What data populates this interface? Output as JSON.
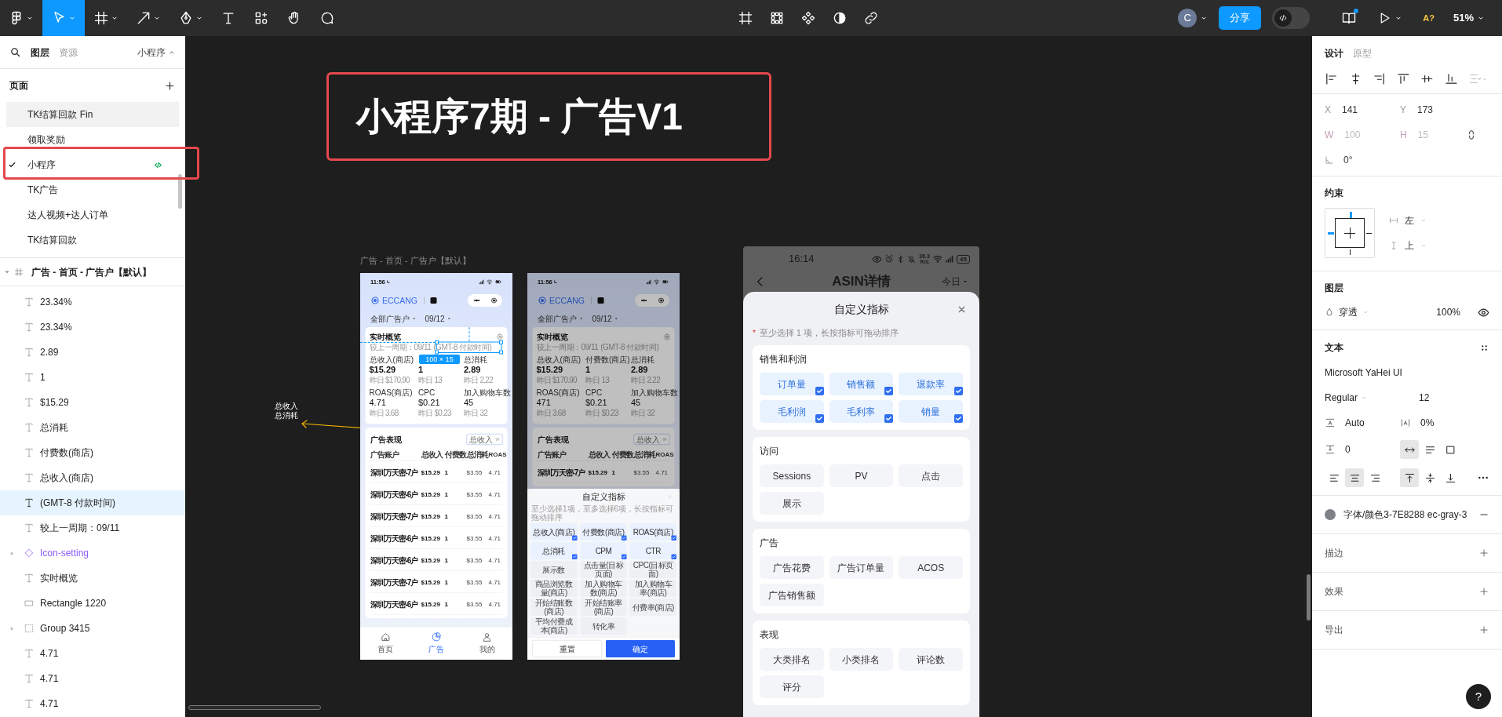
{
  "toolbar": {
    "tools": [
      {
        "kind": "main-menu",
        "selected": false
      },
      {
        "kind": "move",
        "selected": true
      },
      {
        "kind": "frame",
        "selected": false
      },
      {
        "kind": "shape",
        "selected": false
      },
      {
        "kind": "pen",
        "selected": false
      },
      {
        "kind": "text",
        "selected": false
      },
      {
        "kind": "actions",
        "selected": false
      },
      {
        "kind": "hand",
        "selected": false
      },
      {
        "kind": "comment",
        "selected": false
      }
    ],
    "avatar": "C",
    "share_button": "分享",
    "dev_mode": {
      "on": false
    },
    "notifications": true,
    "font_warning": "A?",
    "zoom": "51%"
  },
  "left_panel": {
    "tabs": [
      {
        "label": "图层",
        "selected": true
      },
      {
        "label": "资源",
        "selected": false
      }
    ],
    "page_switcher": "小程序",
    "pages_title": "页面",
    "pages": [
      {
        "label": "TK结算回款 Fin",
        "selected": false,
        "hovered": true,
        "dev_ready": false
      },
      {
        "label": "领取奖励",
        "selected": false,
        "hovered": false,
        "dev_ready": false
      },
      {
        "label": "小程序",
        "selected": true,
        "hovered": false,
        "dev_ready": true
      },
      {
        "label": "TK广告",
        "selected": false,
        "hovered": false,
        "dev_ready": false
      },
      {
        "label": "达人视频+达人订单",
        "selected": false,
        "hovered": false,
        "dev_ready": false
      },
      {
        "label": "TK结算回款",
        "selected": false,
        "hovered": false,
        "dev_ready": false
      }
    ],
    "frame": {
      "label": "广告 - 首页 - 广告户【默认】",
      "expanded": true
    },
    "layers": [
      {
        "kind": "text",
        "label": "23.34%",
        "selected": false
      },
      {
        "kind": "text",
        "label": "23.34%",
        "selected": false
      },
      {
        "kind": "text",
        "label": "2.89",
        "selected": false
      },
      {
        "kind": "text",
        "label": "1",
        "selected": false
      },
      {
        "kind": "text",
        "label": "$15.29",
        "selected": false
      },
      {
        "kind": "text",
        "label": "总消耗",
        "selected": false
      },
      {
        "kind": "text",
        "label": "付费数(商店)",
        "selected": false
      },
      {
        "kind": "text",
        "label": "总收入(商店)",
        "selected": false
      },
      {
        "kind": "text",
        "label": "(GMT-8 付款时间)",
        "selected": true
      },
      {
        "kind": "text",
        "label": "较上一周期：09/11",
        "selected": false
      },
      {
        "kind": "component",
        "label": "Icon-setting",
        "selected": false
      },
      {
        "kind": "text",
        "label": "实时概览",
        "selected": false
      },
      {
        "kind": "rectangle",
        "label": "Rectangle 1220",
        "selected": false
      },
      {
        "kind": "group",
        "label": "Group 3415",
        "selected": false
      },
      {
        "kind": "text",
        "label": "4.71",
        "selected": false
      },
      {
        "kind": "text",
        "label": "4.71",
        "selected": false
      },
      {
        "kind": "text",
        "label": "4.71",
        "selected": false
      }
    ]
  },
  "canvas": {
    "title": "小程序7期 - 广告V1",
    "frame_label": "广告 - 首页 - 广告户【默认】",
    "annotation": [
      "总收入",
      "总消耗"
    ],
    "phones": [
      {
        "kind": "ad-home",
        "time": "11:56",
        "brand": "ECCANG",
        "filters": [
          "全部广告户",
          "09/12"
        ],
        "overview": {
          "title": "实时概览",
          "compare": "较上一周期：09/11",
          "timezone": "(GMT-8 付款时间)",
          "metrics": [
            {
              "label": "总收入(商店)",
              "value": "$15.29",
              "prev": "昨日 $170.90"
            },
            {
              "value": "1",
              "prev": "昨日 13"
            },
            {
              "label": "总消耗",
              "value": "2.89",
              "prev": "昨日 2.22"
            },
            {
              "label": "ROAS(商店)",
              "value": "4.71",
              "prev": "昨日 3.68"
            },
            {
              "label": "CPC",
              "value": "$0.21",
              "prev": "昨日 $0.23"
            },
            {
              "label": "加入购物车数",
              "value": "45",
              "prev": "昨日 32"
            }
          ]
        },
        "selection": {
          "size": "100 × 15"
        },
        "performance": {
          "title": "广告表现",
          "toggle": "总收入",
          "columns": [
            "广告账户",
            "总收入",
            "付费数",
            "总消耗",
            "ROAS"
          ],
          "rows": [
            [
              "深圳万天密-7户",
              "$15.29",
              "1",
              "$3.55",
              "4.71"
            ],
            [
              "深圳万天密-6户",
              "$15.29",
              "1",
              "$3.55",
              "4.71"
            ],
            [
              "深圳万天密-7户",
              "$15.29",
              "1",
              "$3.55",
              "4.71"
            ],
            [
              "深圳万天密-6户",
              "$15.29",
              "1",
              "$3.55",
              "4.71"
            ],
            [
              "深圳万天密-6户",
              "$15.29",
              "1",
              "$3.55",
              "4.71"
            ],
            [
              "深圳万天密-7户",
              "$15.29",
              "1",
              "$3.55",
              "4.71"
            ],
            [
              "深圳万天密-6户",
              "$15.29",
              "1",
              "$3.55",
              "4.71"
            ]
          ]
        },
        "nav": [
          {
            "kind": "home",
            "label": "首页",
            "selected": false
          },
          {
            "kind": "chart",
            "label": "广告",
            "selected": true
          },
          {
            "kind": "user",
            "label": "我的",
            "selected": false
          }
        ]
      },
      {
        "kind": "ad-home",
        "time": "11:56",
        "brand": "ECCANG",
        "filters": [
          "全部广告户",
          "09/12"
        ],
        "overview": {
          "title": "实时概览",
          "compare": "较上一周期：09/11",
          "timezone": "(GMT-8 付款时间)",
          "metrics": [
            {
              "label": "总收入(商店)",
              "value": "$15.29",
              "prev": "昨日 $170.90"
            },
            {
              "label": "付费数(商店)",
              "value": "1",
              "prev": "昨日 13"
            },
            {
              "label": "总消耗",
              "value": "2.89",
              "prev": "昨日 2.22"
            },
            {
              "label": "ROAS(商店)",
              "value": "471",
              "prev": "昨日 3.68"
            },
            {
              "label": "CPC",
              "value": "$0.21",
              "prev": "昨日 $0.23"
            },
            {
              "label": "加入购物车数",
              "value": "45",
              "prev": "昨日 32"
            }
          ]
        },
        "performance": {
          "title": "广告表现",
          "toggle": "总收入",
          "columns": [
            "广告账户",
            "总收入",
            "付费数",
            "总消耗",
            "ROAS"
          ],
          "rows": [
            [
              "深圳万天密-7户",
              "$15.29",
              "1",
              "$3.55",
              "4.71"
            ]
          ]
        },
        "modal": {
          "title": "自定义指标",
          "hint": "至少选择1项，至多选择6项，长按指标可拖动排序",
          "items": [
            {
              "label": "总收入(商店)",
              "checked": true
            },
            {
              "label": "付费数(商店)",
              "checked": true
            },
            {
              "label": "ROAS(商店)",
              "checked": true
            },
            {
              "label": "总消耗",
              "checked": true
            },
            {
              "label": "CPM",
              "checked": true
            },
            {
              "label": "CTR",
              "checked": true
            },
            {
              "label": "展示数",
              "checked": false
            },
            {
              "label": "点击量(目标页面)",
              "checked": false
            },
            {
              "label": "CPC(目标页面)",
              "checked": false
            },
            {
              "label": "商品浏览数量(商店)",
              "checked": false
            },
            {
              "label": "加入购物车数(商店)",
              "checked": false
            },
            {
              "label": "加入购物车率(商店)",
              "checked": false
            },
            {
              "label": "开始结账数(商店)",
              "checked": false
            },
            {
              "label": "开始结账率(商店)",
              "checked": false
            },
            {
              "label": "付费率(商店)",
              "checked": false
            },
            {
              "label": "平均付费成本(商店)",
              "checked": false
            },
            {
              "label": "转化率",
              "checked": false
            }
          ],
          "buttons": [
            "重置",
            "确定"
          ]
        }
      },
      {
        "kind": "asin-metrics",
        "time": "16:14",
        "net_speed": "36.3 K/s",
        "battery": "45",
        "title": "ASIN详情",
        "range": "今日",
        "modal": {
          "title": "自定义指标",
          "required_mark": "*",
          "hint": "至少选择 1 项，长按指标可拖动排序",
          "groups": [
            {
              "title": "销售和利润",
              "items": [
                {
                  "label": "订单量",
                  "checked": true
                },
                {
                  "label": "销售额",
                  "checked": true
                },
                {
                  "label": "退款率",
                  "checked": true
                },
                {
                  "label": "毛利润",
                  "checked": true
                },
                {
                  "label": "毛利率",
                  "checked": true
                },
                {
                  "label": "销量",
                  "checked": true
                }
              ]
            },
            {
              "title": "访问",
              "items": [
                {
                  "label": "Sessions",
                  "checked": false
                },
                {
                  "label": "PV",
                  "checked": false
                },
                {
                  "label": "点击",
                  "checked": false
                },
                {
                  "label": "展示",
                  "checked": false
                }
              ]
            },
            {
              "title": "广告",
              "items": [
                {
                  "label": "广告花费",
                  "checked": false
                },
                {
                  "label": "广告订单量",
                  "checked": false
                },
                {
                  "label": "ACOS",
                  "checked": false
                },
                {
                  "label": "广告销售额",
                  "checked": false
                }
              ]
            },
            {
              "title": "表现",
              "items": [
                {
                  "label": "大类排名",
                  "checked": false
                },
                {
                  "label": "小类排名",
                  "checked": false
                },
                {
                  "label": "评论数",
                  "checked": false
                },
                {
                  "label": "评分",
                  "checked": false
                }
              ]
            }
          ]
        }
      }
    ]
  },
  "right_panel": {
    "tabs": [
      {
        "label": "设计",
        "selected": true
      },
      {
        "label": "原型",
        "selected": false
      }
    ],
    "position": [
      {
        "label": "X",
        "value": "141"
      },
      {
        "label": "Y",
        "value": "173"
      }
    ],
    "size": {
      "disabled": true,
      "fields": [
        {
          "label": "W",
          "value": "100"
        },
        {
          "label": "H",
          "value": "15"
        }
      ]
    },
    "rotation": "0°",
    "constraints": {
      "title": "约束",
      "horizontal": "左",
      "vertical": "上"
    },
    "layer": {
      "title": "图层",
      "blend": "穿透",
      "opacity": "100%",
      "visible": true
    },
    "text": {
      "title": "文本",
      "font": "Microsoft YaHei UI",
      "weight": "Regular",
      "size": "12",
      "line_height": "Auto",
      "letter_spacing": "0%",
      "paragraph_spacing": "0",
      "resize": [
        {
          "kind": "auto-width",
          "selected": true
        },
        {
          "kind": "auto-height",
          "selected": false
        },
        {
          "kind": "fixed",
          "selected": false
        }
      ],
      "align": [
        {
          "kind": "left",
          "selected": false
        },
        {
          "kind": "center",
          "selected": true
        },
        {
          "kind": "right",
          "selected": false
        }
      ],
      "valign": [
        {
          "kind": "top",
          "selected": true
        },
        {
          "kind": "middle",
          "selected": false
        },
        {
          "kind": "bottom",
          "selected": false
        }
      ]
    },
    "fill": {
      "style": "字体/颜色3-7E8288 ec-gray-3",
      "color": "#7e8288"
    },
    "sections": [
      "描边",
      "效果",
      "导出"
    ],
    "help": "?"
  }
}
